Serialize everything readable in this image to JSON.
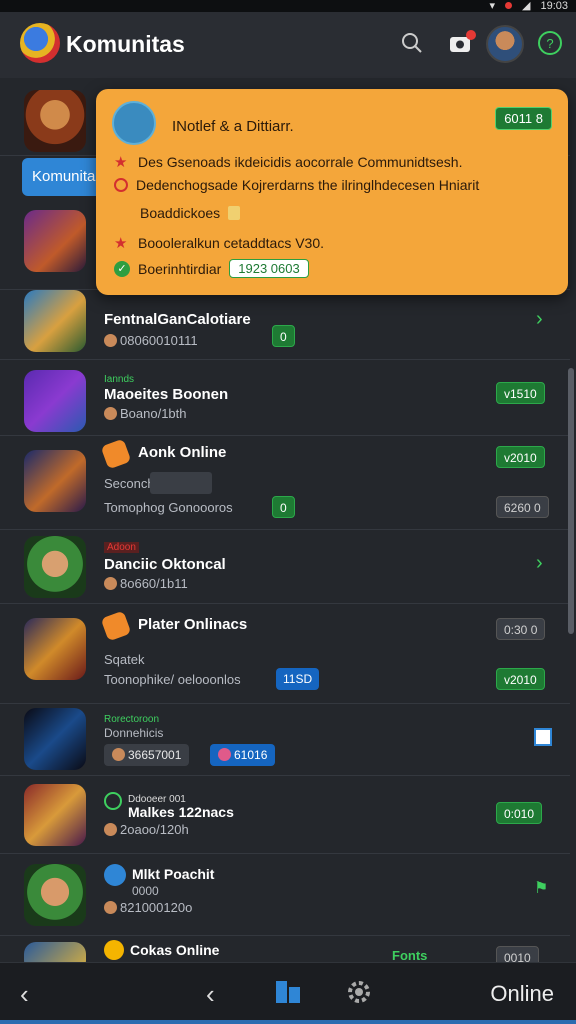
{
  "status_bar": {
    "time": "19:03"
  },
  "header": {
    "title": "Komunitas",
    "icons": [
      "search-icon",
      "notification-icon",
      "avatar",
      "help-icon"
    ]
  },
  "tab": {
    "label": "Komunitas"
  },
  "popup": {
    "title": "INotlef & a Dittiarr.",
    "badge": "6011 8",
    "lines": [
      "Des Gsenoads ikdeicidis aocorrale Communidtsesh.",
      "Dedenchogsade Kojrerdarns the ilringlhdecesen Hniarit",
      "Boaddickoes",
      "Boooleralkun cetaddtacs V30.",
      "Boerinhtirdiar"
    ],
    "value": "1923 0603"
  },
  "rows": [
    {
      "title": "FentnalGanCalotiare",
      "sub": "08060010111",
      "badge": "0"
    },
    {
      "tag": "Iannds",
      "title": "Maoeites Boonen",
      "sub": "Boano/1bth",
      "badge": "v1510"
    },
    {
      "title": "Aonk Online",
      "sub1": "Seconch",
      "sub2": "Tomophog Gonoooros",
      "badge_small": "0",
      "badge1": "v2010",
      "badge2": "6260 0"
    },
    {
      "tag": "Adoon",
      "title": "Danciic Oktoncal",
      "sub": "8o660/1b11"
    },
    {
      "title": "Plater Onlinacs",
      "sub1": "Sqatek",
      "sub2": "Toonophike/ oelooonlos",
      "badge_mid": "11SD",
      "badge1": "0:30 0",
      "badge2": "v2010"
    },
    {
      "tag": "Rorectoroon",
      "title": "Donnehicis",
      "chip1": "36657001",
      "chip2": "61016"
    },
    {
      "tag": "Ddooeer 001",
      "title": "Malkes 122nacs",
      "sub": "2oaoo/120h",
      "badge": "0:010"
    },
    {
      "title": "Mlkt Poachit",
      "sub1": "0000",
      "sub2": "821000120o"
    },
    {
      "title": "Cokas Online",
      "extra": "Fonts",
      "badge": "0010"
    }
  ],
  "bottom_bar": {
    "online_label": "Online"
  },
  "colors": {
    "accent_orange": "#f4a63a",
    "accent_green": "#2ca84a",
    "bg": "#24272c",
    "blue": "#2f86d6"
  }
}
